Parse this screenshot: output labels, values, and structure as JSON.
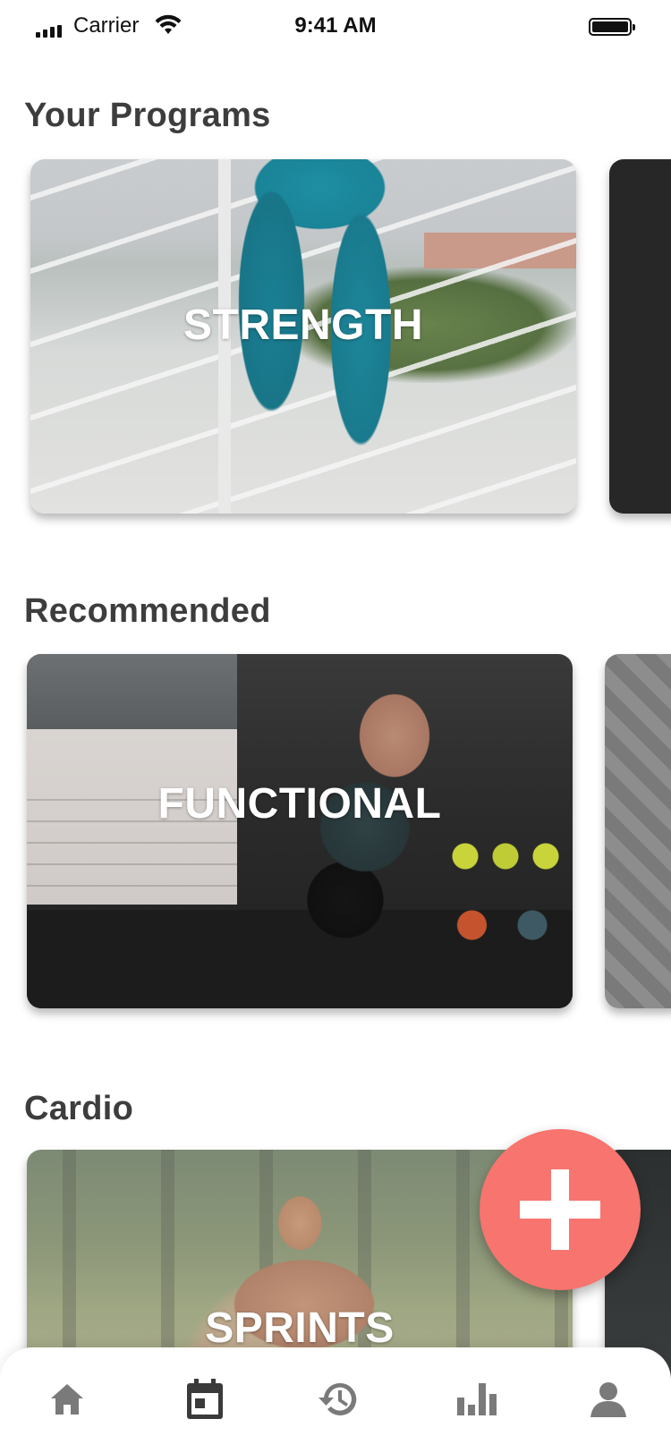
{
  "status_bar": {
    "carrier": "Carrier",
    "time": "9:41 AM"
  },
  "sections": {
    "your_programs": {
      "title": "Your Programs",
      "cards": [
        {
          "label": "STRENGTH"
        }
      ]
    },
    "recommended": {
      "title": "Recommended",
      "cards": [
        {
          "label": "FUNCTIONAL"
        }
      ]
    },
    "cardio": {
      "title": "Cardio",
      "cards": [
        {
          "label": "SPRINTS"
        }
      ]
    }
  },
  "fab": {
    "icon": "plus-icon",
    "color": "#f7746f"
  },
  "tab_bar": {
    "items": [
      {
        "icon": "home-icon"
      },
      {
        "icon": "calendar-icon",
        "active": true
      },
      {
        "icon": "history-icon"
      },
      {
        "icon": "bar-chart-icon"
      },
      {
        "icon": "profile-icon"
      }
    ],
    "active_color": "#3a3a3a",
    "inactive_color": "#7a7a7a"
  }
}
